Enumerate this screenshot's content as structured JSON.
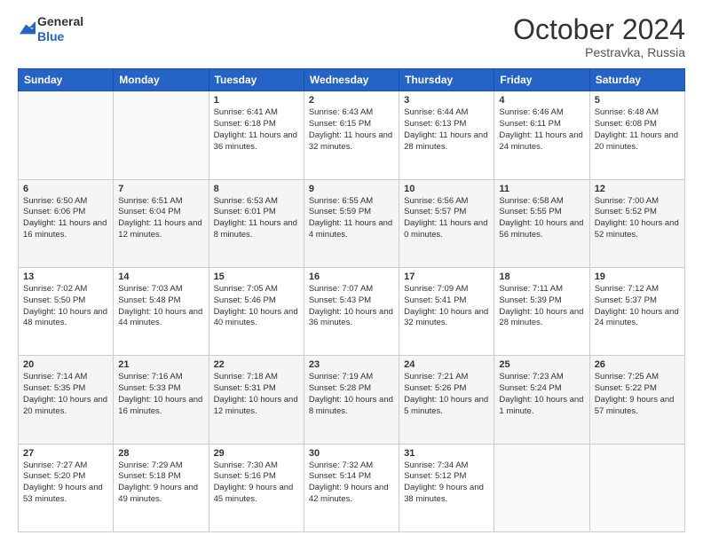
{
  "header": {
    "logo": {
      "line1": "General",
      "line2": "Blue"
    },
    "title": "October 2024",
    "location": "Pestravka, Russia"
  },
  "days_of_week": [
    "Sunday",
    "Monday",
    "Tuesday",
    "Wednesday",
    "Thursday",
    "Friday",
    "Saturday"
  ],
  "weeks": [
    [
      {
        "day": "",
        "info": ""
      },
      {
        "day": "",
        "info": ""
      },
      {
        "day": "1",
        "info": "Sunrise: 6:41 AM\nSunset: 6:18 PM\nDaylight: 11 hours and 36 minutes."
      },
      {
        "day": "2",
        "info": "Sunrise: 6:43 AM\nSunset: 6:15 PM\nDaylight: 11 hours and 32 minutes."
      },
      {
        "day": "3",
        "info": "Sunrise: 6:44 AM\nSunset: 6:13 PM\nDaylight: 11 hours and 28 minutes."
      },
      {
        "day": "4",
        "info": "Sunrise: 6:46 AM\nSunset: 6:11 PM\nDaylight: 11 hours and 24 minutes."
      },
      {
        "day": "5",
        "info": "Sunrise: 6:48 AM\nSunset: 6:08 PM\nDaylight: 11 hours and 20 minutes."
      }
    ],
    [
      {
        "day": "6",
        "info": "Sunrise: 6:50 AM\nSunset: 6:06 PM\nDaylight: 11 hours and 16 minutes."
      },
      {
        "day": "7",
        "info": "Sunrise: 6:51 AM\nSunset: 6:04 PM\nDaylight: 11 hours and 12 minutes."
      },
      {
        "day": "8",
        "info": "Sunrise: 6:53 AM\nSunset: 6:01 PM\nDaylight: 11 hours and 8 minutes."
      },
      {
        "day": "9",
        "info": "Sunrise: 6:55 AM\nSunset: 5:59 PM\nDaylight: 11 hours and 4 minutes."
      },
      {
        "day": "10",
        "info": "Sunrise: 6:56 AM\nSunset: 5:57 PM\nDaylight: 11 hours and 0 minutes."
      },
      {
        "day": "11",
        "info": "Sunrise: 6:58 AM\nSunset: 5:55 PM\nDaylight: 10 hours and 56 minutes."
      },
      {
        "day": "12",
        "info": "Sunrise: 7:00 AM\nSunset: 5:52 PM\nDaylight: 10 hours and 52 minutes."
      }
    ],
    [
      {
        "day": "13",
        "info": "Sunrise: 7:02 AM\nSunset: 5:50 PM\nDaylight: 10 hours and 48 minutes."
      },
      {
        "day": "14",
        "info": "Sunrise: 7:03 AM\nSunset: 5:48 PM\nDaylight: 10 hours and 44 minutes."
      },
      {
        "day": "15",
        "info": "Sunrise: 7:05 AM\nSunset: 5:46 PM\nDaylight: 10 hours and 40 minutes."
      },
      {
        "day": "16",
        "info": "Sunrise: 7:07 AM\nSunset: 5:43 PM\nDaylight: 10 hours and 36 minutes."
      },
      {
        "day": "17",
        "info": "Sunrise: 7:09 AM\nSunset: 5:41 PM\nDaylight: 10 hours and 32 minutes."
      },
      {
        "day": "18",
        "info": "Sunrise: 7:11 AM\nSunset: 5:39 PM\nDaylight: 10 hours and 28 minutes."
      },
      {
        "day": "19",
        "info": "Sunrise: 7:12 AM\nSunset: 5:37 PM\nDaylight: 10 hours and 24 minutes."
      }
    ],
    [
      {
        "day": "20",
        "info": "Sunrise: 7:14 AM\nSunset: 5:35 PM\nDaylight: 10 hours and 20 minutes."
      },
      {
        "day": "21",
        "info": "Sunrise: 7:16 AM\nSunset: 5:33 PM\nDaylight: 10 hours and 16 minutes."
      },
      {
        "day": "22",
        "info": "Sunrise: 7:18 AM\nSunset: 5:31 PM\nDaylight: 10 hours and 12 minutes."
      },
      {
        "day": "23",
        "info": "Sunrise: 7:19 AM\nSunset: 5:28 PM\nDaylight: 10 hours and 8 minutes."
      },
      {
        "day": "24",
        "info": "Sunrise: 7:21 AM\nSunset: 5:26 PM\nDaylight: 10 hours and 5 minutes."
      },
      {
        "day": "25",
        "info": "Sunrise: 7:23 AM\nSunset: 5:24 PM\nDaylight: 10 hours and 1 minute."
      },
      {
        "day": "26",
        "info": "Sunrise: 7:25 AM\nSunset: 5:22 PM\nDaylight: 9 hours and 57 minutes."
      }
    ],
    [
      {
        "day": "27",
        "info": "Sunrise: 7:27 AM\nSunset: 5:20 PM\nDaylight: 9 hours and 53 minutes."
      },
      {
        "day": "28",
        "info": "Sunrise: 7:29 AM\nSunset: 5:18 PM\nDaylight: 9 hours and 49 minutes."
      },
      {
        "day": "29",
        "info": "Sunrise: 7:30 AM\nSunset: 5:16 PM\nDaylight: 9 hours and 45 minutes."
      },
      {
        "day": "30",
        "info": "Sunrise: 7:32 AM\nSunset: 5:14 PM\nDaylight: 9 hours and 42 minutes."
      },
      {
        "day": "31",
        "info": "Sunrise: 7:34 AM\nSunset: 5:12 PM\nDaylight: 9 hours and 38 minutes."
      },
      {
        "day": "",
        "info": ""
      },
      {
        "day": "",
        "info": ""
      }
    ]
  ]
}
